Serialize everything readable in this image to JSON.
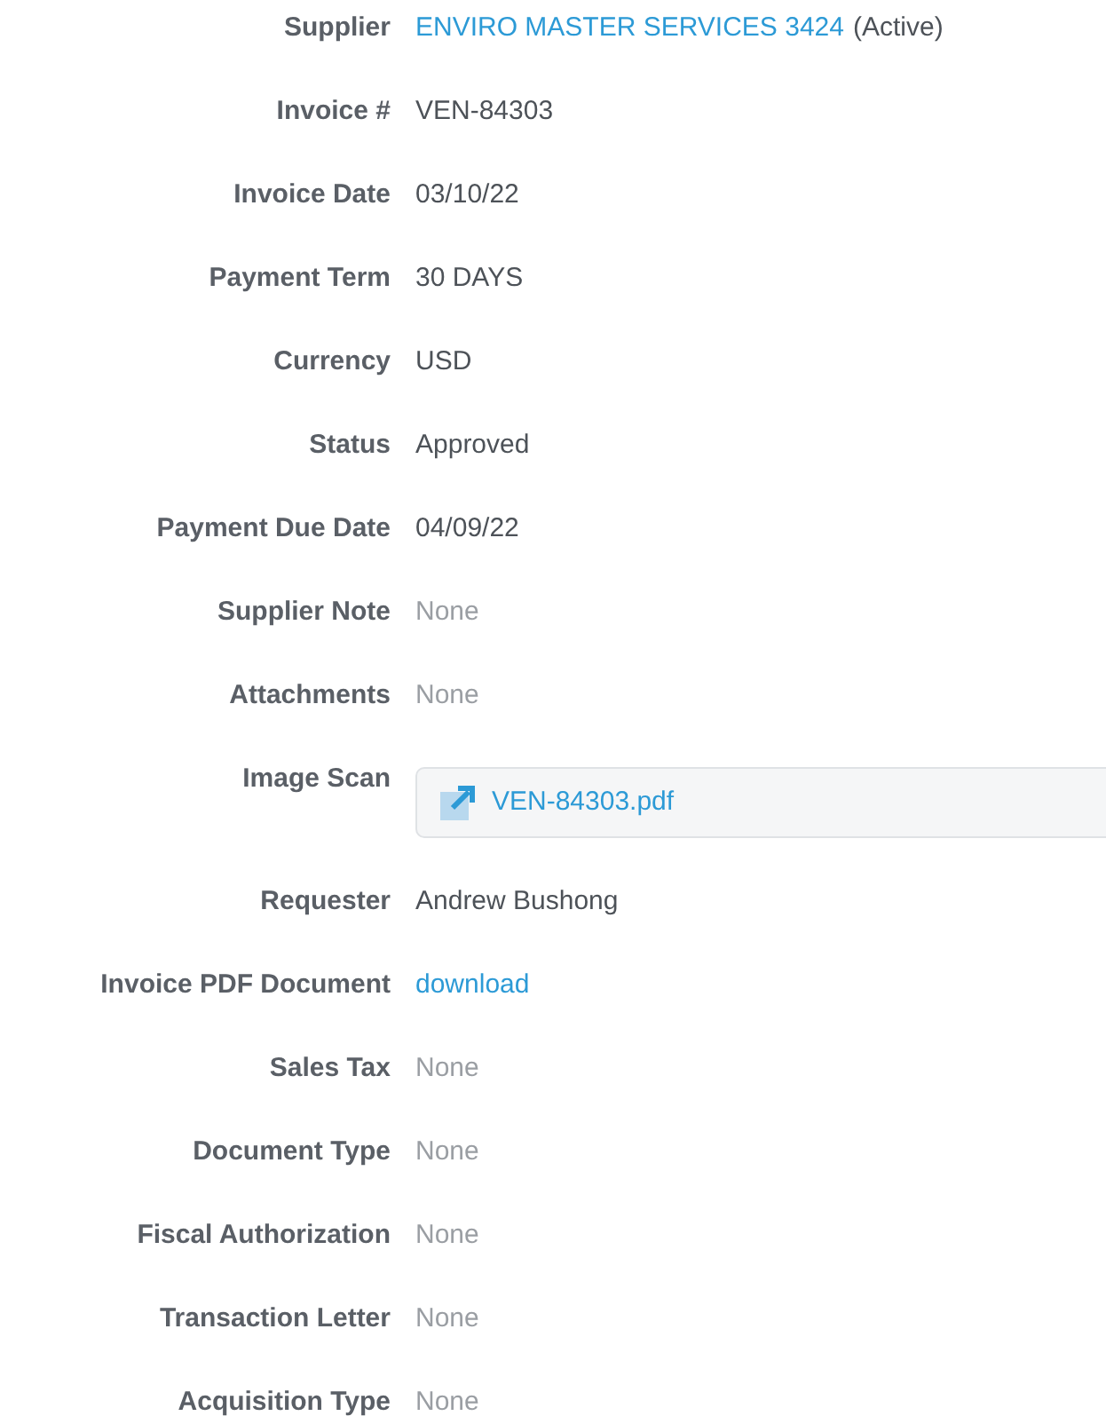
{
  "fields": [
    {
      "label": "Supplier",
      "kind": "supplier",
      "value": "ENVIRO MASTER SERVICES 3424",
      "suffix": "(Active)"
    },
    {
      "label": "Invoice #",
      "kind": "text",
      "value": "VEN-84303"
    },
    {
      "label": "Invoice Date",
      "kind": "text",
      "value": "03/10/22"
    },
    {
      "label": "Payment Term",
      "kind": "text",
      "value": "30 DAYS"
    },
    {
      "label": "Currency",
      "kind": "text",
      "value": "USD"
    },
    {
      "label": "Status",
      "kind": "text",
      "value": "Approved"
    },
    {
      "label": "Payment Due Date",
      "kind": "text",
      "value": "04/09/22"
    },
    {
      "label": "Supplier Note",
      "kind": "muted",
      "value": "None"
    },
    {
      "label": "Attachments",
      "kind": "muted",
      "value": "None"
    },
    {
      "label": "Image Scan",
      "kind": "file",
      "value": "VEN-84303.pdf"
    },
    {
      "label": "Requester",
      "kind": "text",
      "value": "Andrew Bushong"
    },
    {
      "label": "Invoice PDF Document",
      "kind": "link",
      "value": "download"
    },
    {
      "label": "Sales Tax",
      "kind": "muted",
      "value": "None"
    },
    {
      "label": "Document Type",
      "kind": "muted",
      "value": "None"
    },
    {
      "label": "Fiscal Authorization",
      "kind": "muted",
      "value": "None"
    },
    {
      "label": "Transaction Letter",
      "kind": "muted",
      "value": "None"
    },
    {
      "label": "Acquisition Type",
      "kind": "muted",
      "value": "None"
    }
  ]
}
